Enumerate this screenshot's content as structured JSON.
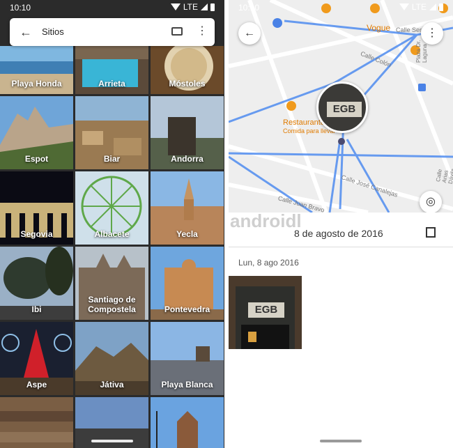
{
  "left": {
    "status": {
      "time": "10:10",
      "network": "LTE"
    },
    "search": {
      "title": "Sitios"
    },
    "places": [
      {
        "label": "Playa Honda"
      },
      {
        "label": "Arrieta"
      },
      {
        "label": "Móstoles"
      },
      {
        "label": "Espot"
      },
      {
        "label": "Biar"
      },
      {
        "label": "Andorra"
      },
      {
        "label": "Segovia"
      },
      {
        "label": "Albacete"
      },
      {
        "label": "Yecla"
      },
      {
        "label": "Ibi"
      },
      {
        "label": "Santiago de Compostela"
      },
      {
        "label": "Pontevedra"
      },
      {
        "label": "Aspe"
      },
      {
        "label": "Játiva"
      },
      {
        "label": "Playa Blanca"
      },
      {
        "label": ""
      },
      {
        "label": ""
      },
      {
        "label": ""
      }
    ]
  },
  "right": {
    "status": {
      "time": "10:10",
      "network": "LTE"
    },
    "map": {
      "labels": {
        "vogue": "Vogue",
        "restaurant": "Restaurante",
        "restaurant_sub": "Comida para llevar",
        "calle_colon": "Calle Colón",
        "calle_ser": "Calle Ser",
        "calle_canalejas": "Calle José Canalejas",
        "calle_juan_bravo": "Calle Juan Bravo",
        "calle_laguna": "Plaza Dr. Laguna",
        "calle_arias": "Calle Arias Dávila"
      },
      "marker_text": "EGB"
    },
    "watermark": "androidl",
    "date_title": "8 de agosto de 2016",
    "sub_date": "Lun, 8 ago 2016",
    "photo_text": "EGB"
  },
  "colors": {
    "accent": "#f09a1c",
    "route": "#4f8cf0",
    "map_bg": "#eeeeee"
  }
}
